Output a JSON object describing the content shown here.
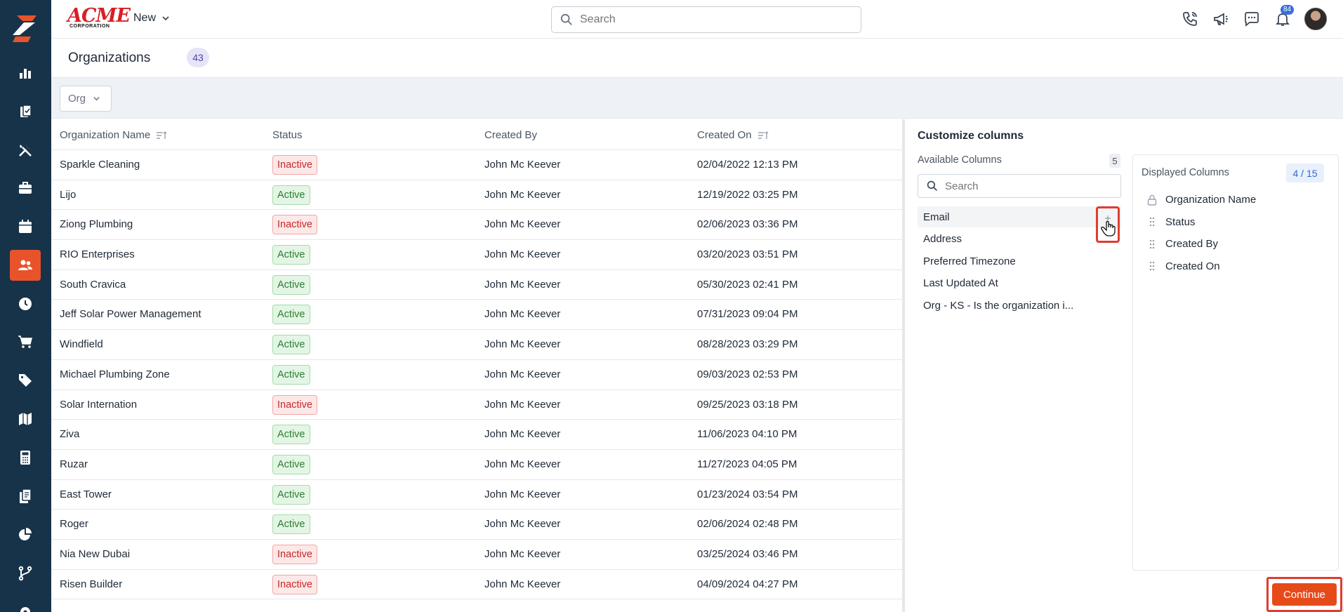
{
  "header": {
    "brand_main": "ACME",
    "brand_sub": "CORPORATION",
    "new_label": "New",
    "search_placeholder": "Search",
    "notification_count": "84"
  },
  "rail": {
    "icons": [
      "bar-chart-icon",
      "clipboard-icon",
      "tools-icon",
      "briefcase-icon",
      "calendar-icon",
      "people-icon",
      "clock-icon",
      "cart-icon",
      "tag-icon",
      "map-icon",
      "calculator-icon",
      "documents-icon",
      "pie-chart-icon",
      "branch-icon"
    ],
    "active": "people-icon",
    "accent": "#e8532b",
    "background": "#17334a"
  },
  "page": {
    "title": "Organizations",
    "count": "43",
    "filter_label": "Org"
  },
  "table": {
    "headers": [
      "Organization Name",
      "Status",
      "Created By",
      "Created On"
    ],
    "rows": [
      {
        "name": "Sparkle Cleaning",
        "status": "Inactive",
        "created_by": "John Mc Keever",
        "created_on": "02/04/2022 12:13 PM"
      },
      {
        "name": "Lijo",
        "status": "Active",
        "created_by": "John Mc Keever",
        "created_on": "12/19/2022 03:25 PM"
      },
      {
        "name": "Ziong Plumbing",
        "status": "Inactive",
        "created_by": "John Mc Keever",
        "created_on": "02/06/2023 03:36 PM"
      },
      {
        "name": "RIO Enterprises",
        "status": "Active",
        "created_by": "John Mc Keever",
        "created_on": "03/20/2023 03:51 PM"
      },
      {
        "name": "South Cravica",
        "status": "Active",
        "created_by": "John Mc Keever",
        "created_on": "05/30/2023 02:41 PM"
      },
      {
        "name": "Jeff Solar Power Management",
        "status": "Active",
        "created_by": "John Mc Keever",
        "created_on": "07/31/2023 09:04 PM"
      },
      {
        "name": "Windfield",
        "status": "Active",
        "created_by": "John Mc Keever",
        "created_on": "08/28/2023 03:29 PM"
      },
      {
        "name": "Michael Plumbing Zone",
        "status": "Active",
        "created_by": "John Mc Keever",
        "created_on": "09/03/2023 02:53 PM"
      },
      {
        "name": "Solar Internation",
        "status": "Inactive",
        "created_by": "John Mc Keever",
        "created_on": "09/25/2023 03:18 PM"
      },
      {
        "name": "Ziva",
        "status": "Active",
        "created_by": "John Mc Keever",
        "created_on": "11/06/2023 04:10 PM"
      },
      {
        "name": "Ruzar",
        "status": "Active",
        "created_by": "John Mc Keever",
        "created_on": "11/27/2023 04:05 PM"
      },
      {
        "name": "East Tower",
        "status": "Active",
        "created_by": "John Mc Keever",
        "created_on": "01/23/2024 03:54 PM"
      },
      {
        "name": "Roger",
        "status": "Active",
        "created_by": "John Mc Keever",
        "created_on": "02/06/2024 02:48 PM"
      },
      {
        "name": "Nia New Dubai",
        "status": "Inactive",
        "created_by": "John Mc Keever",
        "created_on": "03/25/2024 03:46 PM"
      },
      {
        "name": "Risen Builder",
        "status": "Inactive",
        "created_by": "John Mc Keever",
        "created_on": "04/09/2024 04:27 PM"
      }
    ]
  },
  "customize": {
    "title": "Customize columns",
    "available_label": "Available Columns",
    "available_count": "5",
    "search_placeholder": "Search",
    "available": [
      "Email",
      "Address",
      "Preferred Timezone",
      "Last Updated At",
      "Org - KS - Is the organization i..."
    ],
    "displayed_label": "Displayed Columns",
    "displayed_count": "4 / 15",
    "displayed": [
      "Organization Name",
      "Status",
      "Created By",
      "Created On"
    ],
    "continue_label": "Continue",
    "highlight_color": "#e03c31"
  }
}
